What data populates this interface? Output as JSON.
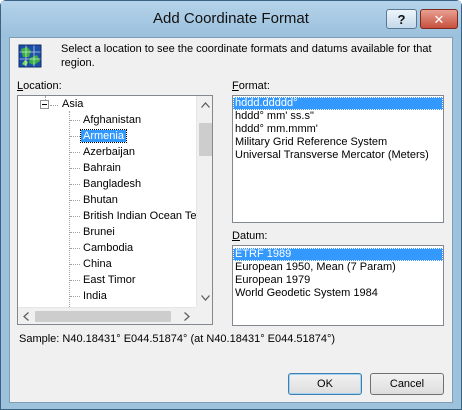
{
  "window": {
    "title": "Add Coordinate Format",
    "help_label": "?",
    "close_label": "✕"
  },
  "instruction": "Select a location to see the coordinate formats and datums available for that region.",
  "location": {
    "label_prefix": "",
    "label_key": "L",
    "label_rest": "ocation:",
    "root": "Asia",
    "items": [
      "Afghanistan",
      "Armenia",
      "Azerbaijan",
      "Bahrain",
      "Bangladesh",
      "Bhutan",
      "British Indian Ocean Ter",
      "Brunei",
      "Cambodia",
      "China",
      "East Timor",
      "India"
    ],
    "selected": "Armenia"
  },
  "format": {
    "label_key": "F",
    "label_rest": "ormat:",
    "items": [
      "hddd.ddddd°",
      "hddd° mm' ss.s\"",
      "hddd° mm.mmm'",
      "Military Grid Reference System",
      "Universal Transverse Mercator (Meters)"
    ],
    "selected": "hddd.ddddd°"
  },
  "datum": {
    "label_key": "D",
    "label_rest": "atum:",
    "items": [
      "ETRF 1989",
      "European 1950, Mean (7 Param)",
      "European 1979",
      "World Geodetic System 1984"
    ],
    "selected": "ETRF 1989"
  },
  "sample": "Sample: N40.18431° E044.51874° (at N40.18431° E044.51874°)",
  "buttons": {
    "ok": "OK",
    "cancel": "Cancel"
  },
  "colors": {
    "selection": "#3399ff",
    "titlebar": "#9ac0dc",
    "client": "#f0f0f0"
  }
}
